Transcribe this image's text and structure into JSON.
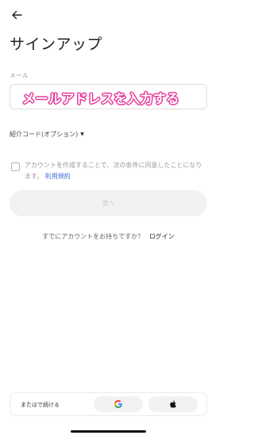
{
  "header": {
    "back_icon": "arrow-left-icon",
    "title": "サインアップ"
  },
  "email": {
    "label": "メール",
    "value": "",
    "placeholder": "",
    "overlay_annotation": "メールアドレスを入力する",
    "annotation_color": "#e8389a"
  },
  "referral": {
    "label": "紹介コード(オプション)",
    "caret_icon": "caret-down-icon"
  },
  "terms": {
    "checked": false,
    "text": "アカウントを作成することで、次の条件に同意したことになります。",
    "link_label": "利用規約",
    "link_color": "#3f6fd6"
  },
  "next_button": {
    "label": "次へ",
    "state": "disabled"
  },
  "login_prompt": {
    "text": "すでにアカウントをお持ちですか？",
    "link_label": "ログイン"
  },
  "social": {
    "continue_label": "またはで続ける",
    "google_icon": "google-icon",
    "apple_icon": "apple-icon"
  }
}
